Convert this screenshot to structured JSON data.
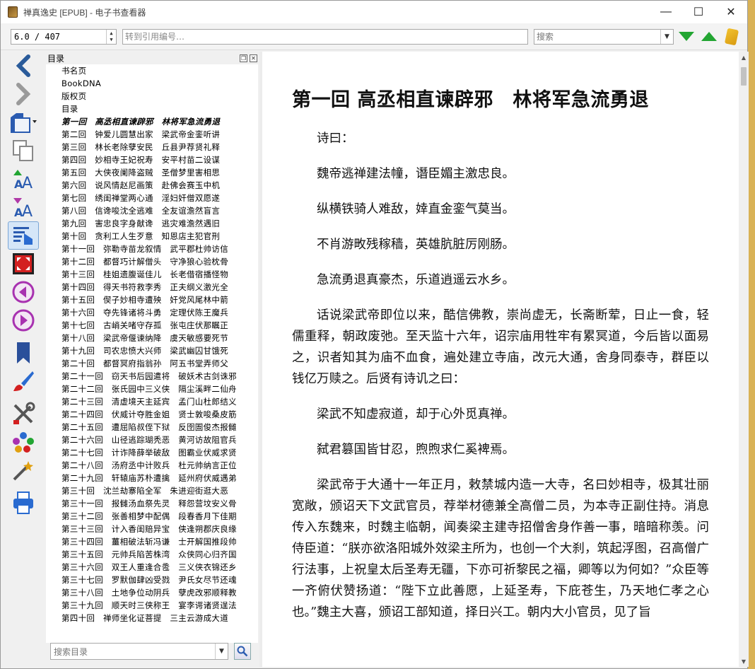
{
  "window": {
    "title": "禅真逸史 [EPUB] - 电子书查看器",
    "controls": {
      "minimize": "—",
      "maximize": "☐",
      "close": "✕"
    }
  },
  "toolbar": {
    "position_value": "6.0 / 407",
    "goto_placeholder": "转到引用编号…",
    "search_placeholder": "搜索",
    "next_match_icon": "arrow-down-icon",
    "prev_match_icon": "arrow-up-icon"
  },
  "colors": {
    "accent_green": "#22a532",
    "active_button": "#d5e6f8",
    "nav_arrow": "#2a5b9a"
  },
  "leftbar": {
    "icons": [
      "back-icon",
      "forward-icon",
      "open-book-icon",
      "copy-icon",
      "font-larger-icon",
      "font-smaller-icon",
      "toc-icon",
      "fullscreen-icon",
      "previous-page-icon",
      "next-page-icon",
      "bookmarks-icon",
      "style-brush-icon",
      "preferences-icon",
      "metadata-icon",
      "inspector-icon",
      "print-icon"
    ]
  },
  "toc": {
    "header": "目录",
    "search_placeholder": "搜索目录",
    "items": [
      "书名页",
      "BookDNA",
      "版权页",
      "目录",
      "第一回　高丞相直谏辟邪　林将军急流勇退",
      "第二回　钟爱儿圆慧出家　梁武帝金銮听讲",
      "第三回　林长老除孽安民　丘县尹荐贤礼释",
      "第四回　妙相寺王妃祝寿　安平村苗二设谋",
      "第五回　大侠夜阑降盗贼　圣僧梦里害相思",
      "第六回　说风情赵尼画策　赴佛会赛玉中机",
      "第七回　绣闺禅堂两心通　淫妇奸僧双愿遂",
      "第八回　信谗唆沈全逃难　全友谊澹然盲言",
      "第九回　害忠良字身献谗　逃灾难澹然遇旧",
      "第十回　贪利工人生歹意　知恩店主犯官刑",
      "第十一回　弥勒寺苗龙叙情　武平郡杜帅访信",
      "第十二回　都督巧计解僧头　守净狼心验枕骨",
      "第十三回　桂姐遗腹诞佳儿　长老借宿播怪物",
      "第十四回　得天书符救李秀　正夫纲义激光全",
      "第十五回　偰子妙相寺遭殃　奸党风尾林中箭",
      "第十六回　夺先锋诸将斗勇　定理伏陈王魔兵",
      "第十七回　古峭关啫守存孤　张屯庄伏那瞩正",
      "第十八回　梁武帝偃谏纳降　虞天敏感要死节",
      "第十九回　司农忠愤大兴师　梁武幽囚甘饿死",
      "第二十回　都督冥府指翁孙　阿五书堂弄师父",
      "第二十一回　窃天书后园遣将　破妖术古剑诛邪",
      "第二十二回　张氏园中三义侠　隔尘溪畔二仙舟",
      "第二十三回　清虚境天主延宾　孟门山杜郎结义",
      "第二十四回　伏威计夺胜金姐　贤士敦唆桑皮筋",
      "第二十五回　遭屈陷叔侄下狱　反囹圄俊杰报雠",
      "第二十六回　山径逃踪瑚秃恶　黄河访故阻官兵",
      "第二十七回　计诈降薛举破敌　图霸业伏威求贤",
      "第二十八回　汤府丞中计败兵　杜元帅纳言正位",
      "第二十九回　轩辕庙苏朴遭擒　延州府伏威遇弟",
      "第三十回　沈兰劫寨陷全军　朱进迎街逛大恶",
      "第三十一回　报雠汤血祭先灵　释怨营坟安义骨",
      "第三十二回　张善相梦中配偶　段春香月下佳期",
      "第三十三回　计入香闺赔异宝　侠逢朔郡庆良缘",
      "第三十四回　薑相破法斩冯谦　士开解国推段帅",
      "第三十五回　元帅兵陷苦株湾　众侠同心归齐国",
      "第三十六回　双王人重逢合卺　三义侠衣锦还乡",
      "第三十七回　罗默伽肆凶受戮　尹氏女尽节还魂",
      "第三十八回　土地争位动阴兵　孽虎改邪顺释教",
      "第三十九回　顺天时三侠称王　宴李谔诸贤逞法",
      "第四十回　禅师坐化证菩提　三主云游成大道"
    ],
    "current_index": 4
  },
  "reader": {
    "chapter_title": "第一回 高丞相直谏辟邪　林将军急流勇退",
    "paragraphs": [
      "诗曰：",
      "魏帝逃禅建法幢，谮臣媚主激忠良。",
      "纵横铁骑人难敌，婞直金銮气莫当。",
      "不肖游畋残稼穑，英雄肮脏厉刚肠。",
      "急流勇退真豪杰，乐道逍遥云水乡。",
      "话说梁武帝即位以来，酷信佛教，崇尚虚无，长斋断荤，日止一食，轻儒重释，朝政废弛。至天监十六年，诏宗庙用牲牢有累冥道，今后皆以面易之，识者知其为庙不血食，遍处建立寺庙，改元大通，舍身同泰寺，群臣以钱亿万赎之。后贤有诗讥之曰：",
      "梁武不知虚寂道，却于心外觅真禅。",
      "弑君篡国皆甘忍，煦煦求仁奚裨焉。",
      "梁武帝于大通十一年正月，敕禁城内造一大寺，名曰妙相寺，极其壮丽宽敞，颁诏天下文武官员，荐举材德兼全高僧二员，为本寺正副住持。消息传入东魏来，时魏主临朝，闻奏梁主建寺招僧舍身作善一事，暗暗称羡。问侍臣道：“朕亦欲洛阳城外效梁主所为，也创一个大刹，筑起浮图，召高僧广行法事，上祝皇太后圣寿无疆，下亦可祈黎民之福，卿等以为何如？”众臣等一齐俯伏赞扬道：“陛下立此善愿，上延圣寿，下庇苍生，乃天地仁孝之心也。”魏主大喜，颁诏工部知道，择日兴工。朝内大小官员，见了旨"
    ]
  }
}
